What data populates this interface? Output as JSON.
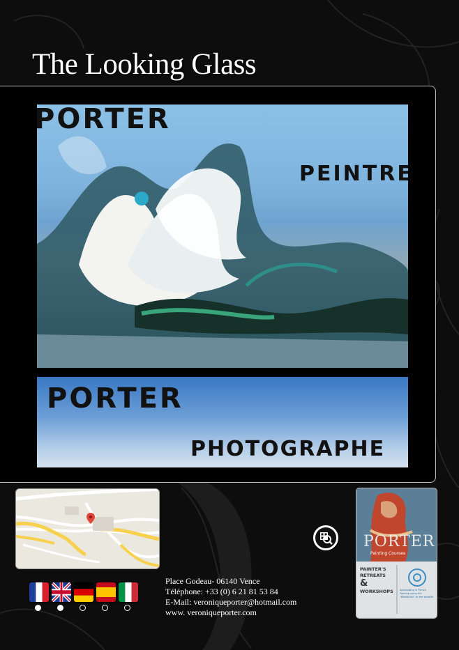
{
  "title": "The Looking Glass",
  "artwork": {
    "painting_top_word": "PORTER",
    "painting_side_word": "PEINTRE",
    "photo_top_word": "PORTER",
    "photo_bottom_word": "PHOTOGRAPHE"
  },
  "contact": {
    "address": "Place Godeau- 06140 Vence",
    "phone": "Téléphone: +33 (0) 6 21 81 53 84",
    "email": "E-Mail: veroniqueporter@hotmail.com",
    "website": "www. veroniqueporter.com"
  },
  "language_flags": [
    "french-flag-icon",
    "uk-flag-icon",
    "german-flag-icon",
    "spanish-flag-icon",
    "italian-flag-icon"
  ],
  "pager": {
    "total": 5,
    "active": [
      0,
      1
    ]
  },
  "poster": {
    "brand": "PORTER",
    "subtitle": "Painting Courses",
    "left_text": [
      "PAINTER'S",
      "RETREATS",
      "&",
      "WORKSHOPS"
    ],
    "right_text": "Specializing in French Painting using the \"Westonian\" as the website"
  },
  "colors": {
    "background": "#0d0d0d",
    "frame_border": "#bdbdbd",
    "text": "#ffffff"
  }
}
